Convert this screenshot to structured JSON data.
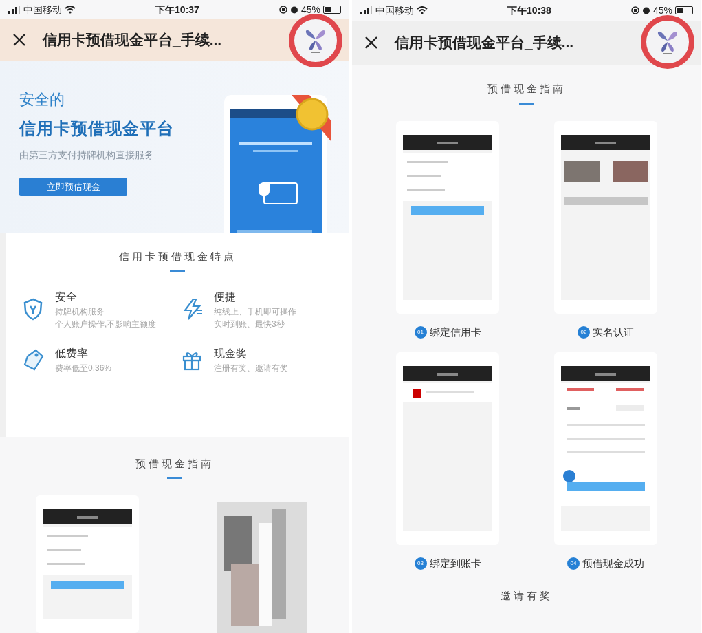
{
  "phones": [
    {
      "kind": "home",
      "status_bar": {
        "carrier": "中国移动",
        "time": "下午10:37",
        "battery": "45%"
      },
      "nav": {
        "title": "信用卡预借现金平台_手续..."
      },
      "hero": {
        "line_1": "安全的",
        "line_2": "信用卡预借现金平台",
        "subtitle": "由第三方支付持牌机构直接服务",
        "button": "立即预借现金"
      },
      "features": {
        "heading": "信用卡预借现金特点",
        "items": [
          {
            "title": "安全",
            "lines": [
              "持牌机构服务",
              "个人账户操作,不影响主额度"
            ]
          },
          {
            "title": "便捷",
            "lines": [
              "纯线上、手机即可操作",
              "实时到账、最快3秒"
            ]
          },
          {
            "title": "低费率",
            "lines": [
              "费率低至0.36%"
            ]
          },
          {
            "title": "现金奖",
            "lines": [
              "注册有奖、邀请有奖"
            ]
          }
        ]
      },
      "guide": {
        "heading": "预借现金指南",
        "steps": [
          {
            "kind": "form"
          },
          {
            "kind": "blurred"
          }
        ]
      }
    },
    {
      "kind": "guide",
      "status_bar": {
        "carrier": "中国移动",
        "time": "下午10:38",
        "battery": "45%"
      },
      "nav": {
        "title": "信用卡预借现金平台_手续..."
      },
      "guide": {
        "heading": "预借现金指南",
        "steps": [
          {
            "kind": "form",
            "number": "01",
            "label": "绑定信用卡"
          },
          {
            "kind": "photos",
            "number": "02",
            "label": "实名认证"
          },
          {
            "kind": "card",
            "number": "03",
            "label": "绑定到账卡"
          },
          {
            "kind": "amount",
            "number": "04",
            "label": "预借现金成功"
          }
        ]
      },
      "next_heading": "邀请有奖"
    }
  ]
}
